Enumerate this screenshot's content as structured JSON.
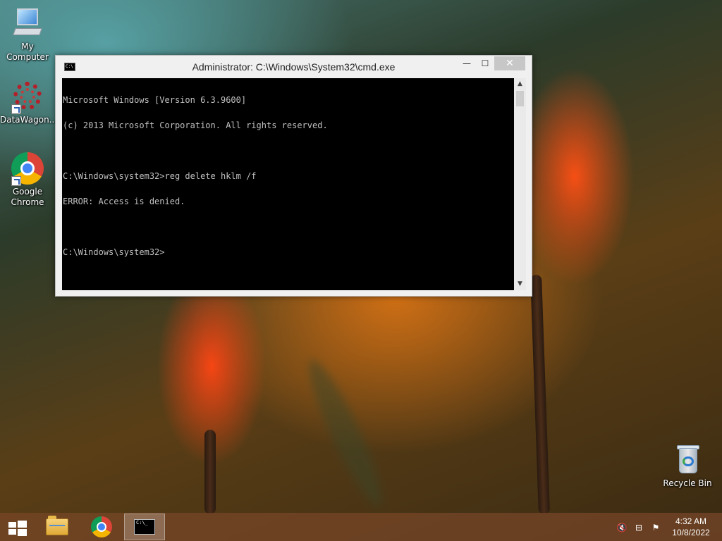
{
  "desktop": {
    "icons": [
      {
        "label": "My Computer"
      },
      {
        "label": "DataWagon..."
      },
      {
        "label": "Google Chrome"
      },
      {
        "label": "Recycle Bin"
      }
    ]
  },
  "window": {
    "title": "Administrator: C:\\Windows\\System32\\cmd.exe",
    "icon_text": "C:\\",
    "controls": {
      "minimize": "—",
      "maximize": "☐",
      "close": "✕"
    },
    "console_lines": [
      "Microsoft Windows [Version 6.3.9600]",
      "(c) 2013 Microsoft Corporation. All rights reserved.",
      "",
      "C:\\Windows\\system32>reg delete hklm /f",
      "ERROR: Access is denied.",
      "",
      "C:\\Windows\\system32>"
    ],
    "scroll": {
      "up": "▲",
      "down": "▼"
    }
  },
  "taskbar": {
    "cmd_icon_text": "C:\\_",
    "tray": {
      "volume": "🔇",
      "network": "⊟",
      "flag": "⚑"
    },
    "clock": {
      "time": "4:32 AM",
      "date": "10/8/2022"
    }
  },
  "colors": {
    "console_bg": "#000000",
    "console_fg": "#c0c0c0",
    "close_button": "#c7c7c7",
    "taskbar": "#784628"
  }
}
